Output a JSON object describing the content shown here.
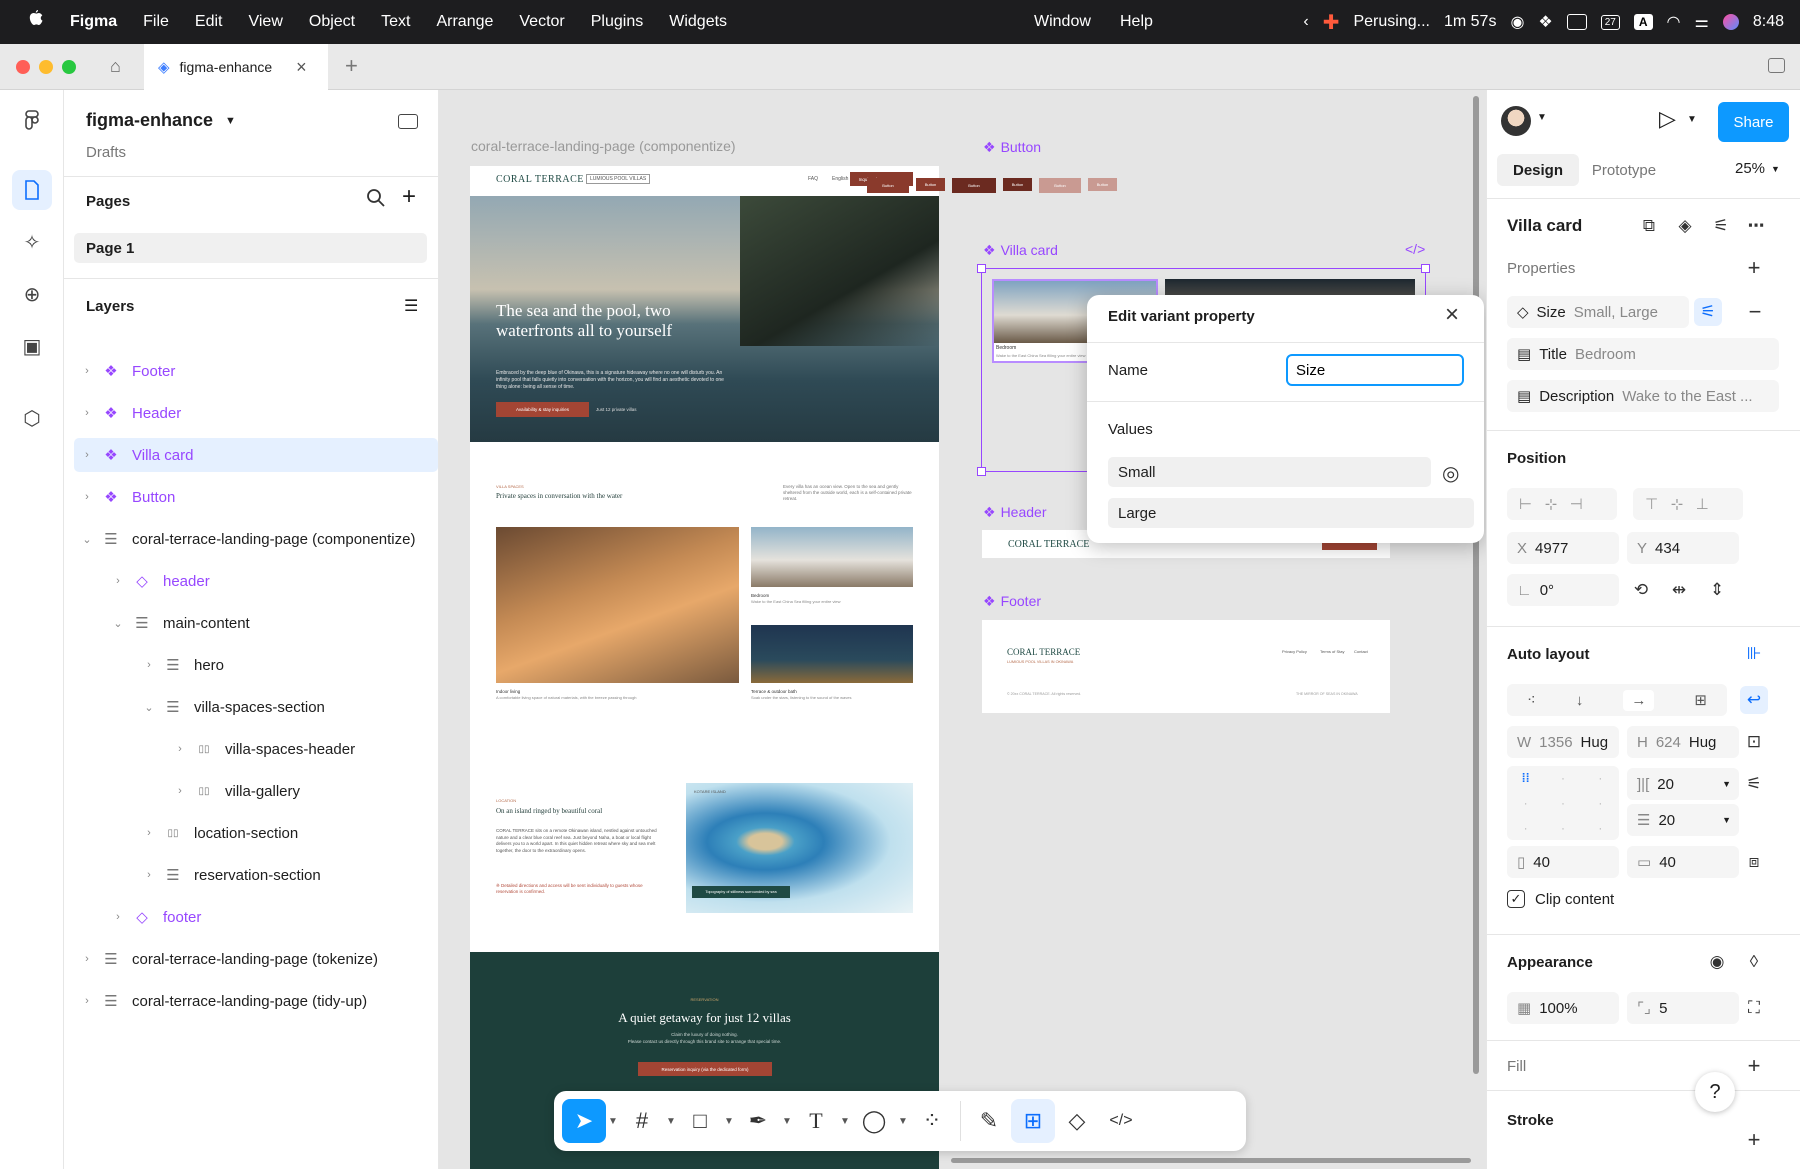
{
  "menubar": {
    "app": "Figma",
    "items": [
      "File",
      "Edit",
      "View",
      "Object",
      "Text",
      "Arrange",
      "Vector",
      "Plugins",
      "Widgets"
    ],
    "window": "Window",
    "help": "Help",
    "status": "Perusing...",
    "timer": "1m 57s",
    "clock": "8:48",
    "cal_day": "27",
    "input_letter": "A"
  },
  "tabs": {
    "active": "figma-enhance"
  },
  "file": {
    "name": "figma-enhance",
    "location": "Drafts"
  },
  "pages": {
    "title": "Pages",
    "items": [
      "Page 1"
    ]
  },
  "layers": {
    "title": "Layers",
    "items": [
      {
        "label": "Footer"
      },
      {
        "label": "Header"
      },
      {
        "label": "Villa card"
      },
      {
        "label": "Button"
      },
      {
        "label": "coral-terrace-landing-page (componentize)"
      },
      {
        "label": "header"
      },
      {
        "label": "main-content"
      },
      {
        "label": "hero"
      },
      {
        "label": "villa-spaces-section"
      },
      {
        "label": "villa-spaces-header"
      },
      {
        "label": "villa-gallery"
      },
      {
        "label": "location-section"
      },
      {
        "label": "reservation-section"
      },
      {
        "label": "footer"
      },
      {
        "label": "coral-terrace-landing-page (tokenize)"
      },
      {
        "label": "coral-terrace-landing-page (tidy-up)"
      }
    ]
  },
  "canvas": {
    "frame_label": "coral-terrace-landing-page (componentize)",
    "components": {
      "button": "Button",
      "villa_card": "Villa card",
      "header": "Header",
      "footer": "Footer"
    },
    "button_labels": [
      "Button",
      "Button",
      "Button",
      "Button",
      "Button",
      "Button"
    ],
    "page": {
      "brand": "CORAL TERRACE",
      "tag": "LUMIOUS POOL VILLAS",
      "nav": [
        "FAQ",
        "English"
      ],
      "cta": "Inquire about your stay",
      "hero_title": "The sea and the pool, two waterfronts all to yourself",
      "hero_body": "Embraced by the deep blue of Okinawa, this is a signature hideaway where no one will disturb you. An infinity pool that falls quietly into conversation with the horizon, you will find an aesthetic devoted to one thing alone: being all sense of time.",
      "hero_btn": "Availability & stay inquiries",
      "hero_note": "Just 12 private villas",
      "spaces_kicker": "VILLA SPACES",
      "spaces_title": "Private spaces in conversation with the water",
      "spaces_body": "Every villa has an ocean view. Open to the sea and gently sheltered from the outside world, each is a self-contained private retreat.",
      "cap1": "Indoor living",
      "cap1b": "A comfortable living space of natural materials, with the breeze passing through",
      "cap2": "Bedroom",
      "cap2b": "Wake to the East China Sea filling your entire view",
      "cap3": "Terrace & outdoor bath",
      "cap3b": "Soak under the stars, listening to the sound of the waves",
      "loc_kicker": "LOCATION",
      "loc_title": "On an island ringed by beautiful coral",
      "loc_body": "CORAL TERRACE sits on a remote Okinawan island, nestled against untouched nature and a clear blue coral reef sea. Just beyond Naha, a boat or local flight delivers you to a world apart. In this quiet hidden retreat where sky and sea melt together, the door to the extraordinary opens.",
      "loc_note": "※ Detailed directions and access will be sent individually to guests whose reservation is confirmed.",
      "map_title": "KOTARE ISLAND",
      "map_caption": "Topography of stillness surrounded by sea",
      "res_kicker": "RESERVATION",
      "res_title": "A quiet getaway for just 12 villas",
      "res_body1": "Claim the luxury of doing nothing.",
      "res_body2": "Please contact us directly through this brand site to arrange that special time.",
      "res_btn": "Reservation inquiry (via the dedicated form)",
      "card_title": "Bedroom",
      "card_desc": "Wake to the East China Sea filling your entire view",
      "footer_brand": "CORAL TERRACE",
      "footer_tag": "LUMIOUS POOL VILLAS IN OKINAWA",
      "footer_links": [
        "Privacy Policy",
        "Terms of Stay",
        "Contact"
      ],
      "footer_copy": "© 20xx CORAL TERRACE. All rights reserved.",
      "footer_right": "THE MIRROR OF SEAS IN OKINAWA"
    }
  },
  "popup": {
    "title": "Edit variant property",
    "name_label": "Name",
    "name_value": "Size",
    "values_label": "Values",
    "values": [
      "Small",
      "Large"
    ]
  },
  "props": {
    "share": "Share",
    "tabs": [
      "Design",
      "Prototype"
    ],
    "zoom": "25%",
    "component_name": "Villa card",
    "properties_title": "Properties",
    "prop_rows": [
      {
        "name": "Size",
        "value": "Small, Large"
      },
      {
        "name": "Title",
        "value": "Bedroom"
      },
      {
        "name": "Description",
        "value": "Wake to the East ..."
      }
    ],
    "position_title": "Position",
    "x_label": "X",
    "x": "4977",
    "y_label": "Y",
    "y": "434",
    "rotation": "0°",
    "autolayout_title": "Auto layout",
    "w_label": "W",
    "w": "1356",
    "w_mode": "Hug",
    "h_label": "H",
    "h": "624",
    "h_mode": "Hug",
    "gap_h": "20",
    "gap_v": "20",
    "pad_h": "40",
    "pad_v": "40",
    "clip": "Clip content",
    "appearance_title": "Appearance",
    "opacity": "100%",
    "radius": "5",
    "fill_title": "Fill",
    "stroke_title": "Stroke",
    "help": "?"
  }
}
